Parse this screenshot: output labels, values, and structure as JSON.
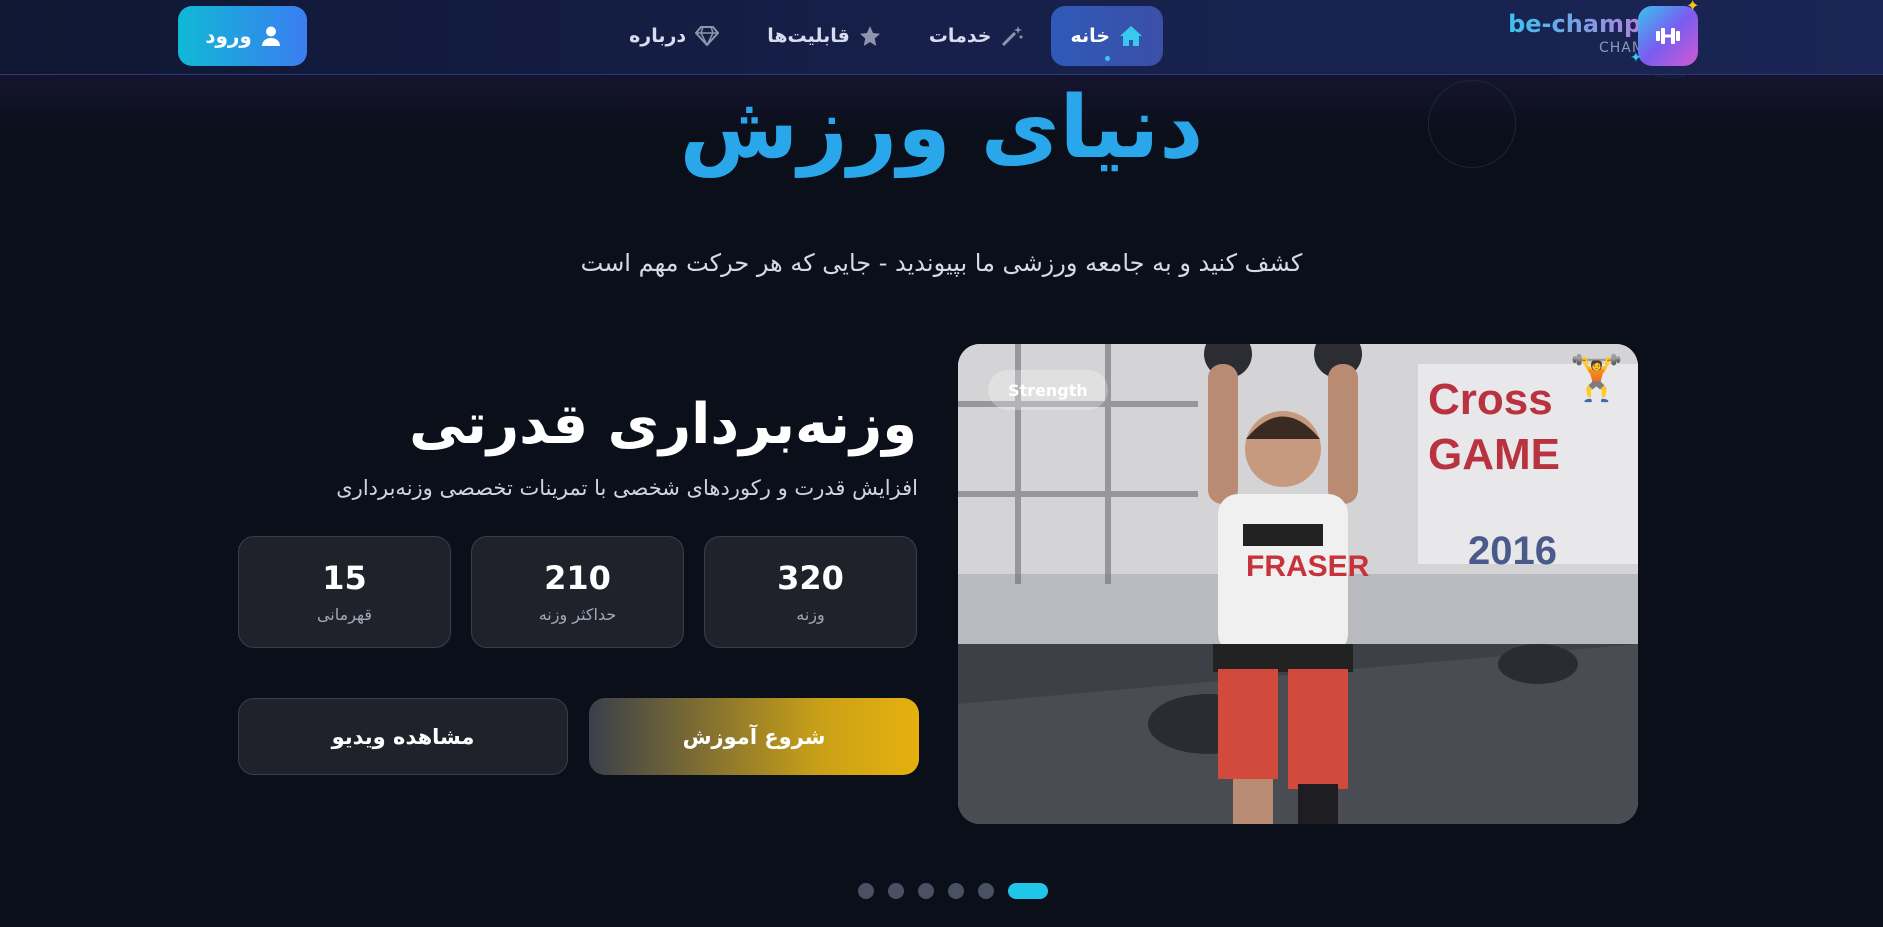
{
  "header": {
    "login_label": "ورود",
    "nav": [
      {
        "label": "خانه",
        "icon": "home-icon"
      },
      {
        "label": "خدمات",
        "icon": "magic-wand-icon"
      },
      {
        "label": "قابلیت‌ها",
        "icon": "star-icon"
      },
      {
        "label": "درباره",
        "icon": "diamond-icon"
      }
    ],
    "brand_name": "be-champion",
    "brand_sub": "CHAMPION"
  },
  "hero": {
    "title": "دنیای ورزش",
    "subtitle": "کشف کنید و به جامعه ورزشی ما بپیوندید - جایی که هر حرکت مهم است"
  },
  "card": {
    "tag": "Strength",
    "title": "وزنه‌برداری قدرتی",
    "description": "افزایش قدرت و رکوردهای شخصی با تمرینات تخصصی وزنه‌برداری",
    "stats": [
      {
        "value": "320",
        "label": "وزنه"
      },
      {
        "value": "210",
        "label": "حداکثر وزنه"
      },
      {
        "value": "15",
        "label": "قهرمانی"
      }
    ],
    "start_label": "شروع آموزش",
    "video_label": "مشاهده ویدیو",
    "emoji": "🏋️"
  },
  "carousel": {
    "count": 6,
    "active_index": 5
  },
  "colors": {
    "accent": "#2aa7ea",
    "active_dot": "#20c6e8",
    "gold": "#e6b10e"
  }
}
